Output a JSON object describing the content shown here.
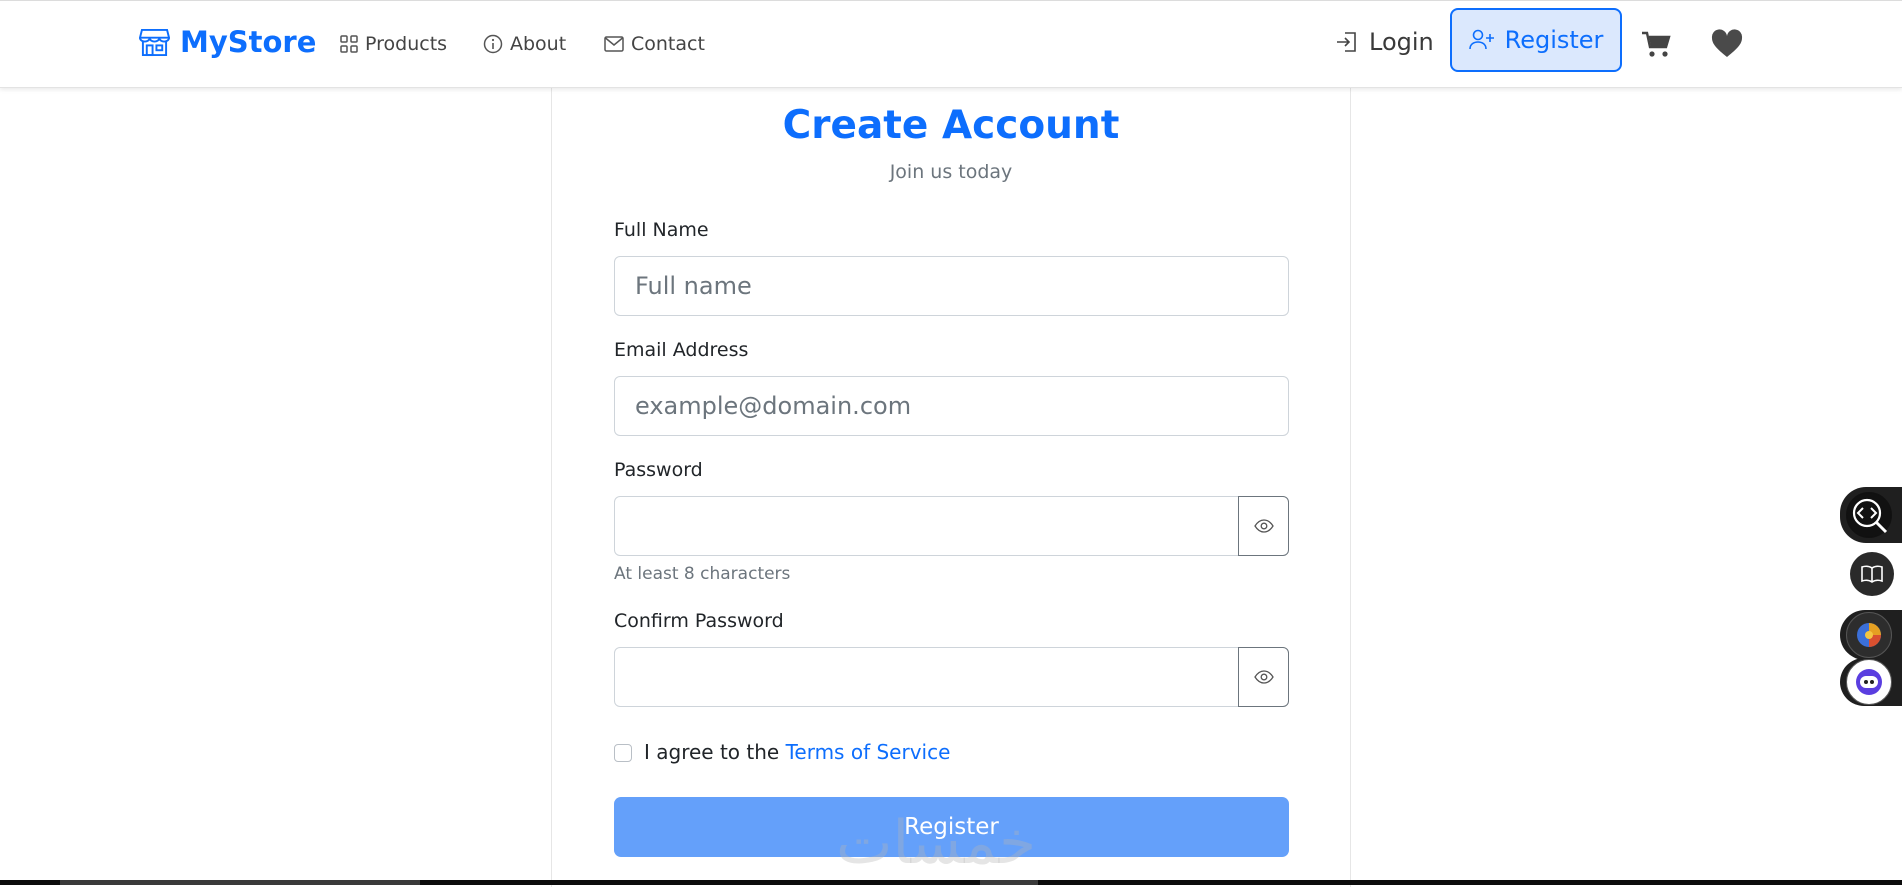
{
  "navbar": {
    "brand": "MyStore",
    "links": [
      {
        "label": "Products",
        "icon": "grid-icon"
      },
      {
        "label": "About",
        "icon": "info-circle-icon"
      },
      {
        "label": "Contact",
        "icon": "envelope-icon"
      }
    ],
    "login_label": "Login",
    "register_label": "Register"
  },
  "form": {
    "title": "Create Account",
    "subtitle": "Join us today",
    "full_name_label": "Full Name",
    "full_name_placeholder": "Full name",
    "email_label": "Email Address",
    "email_placeholder": "example@domain.com",
    "password_label": "Password",
    "password_help": "At least 8 characters",
    "confirm_label": "Confirm Password",
    "agree_text": "I agree to the",
    "terms_link": "Terms of Service",
    "submit_label": "Register"
  },
  "colors": {
    "primary": "#0d6efd",
    "submit_disabled": "#64a0fa",
    "register_btn_bg": "#dbe8fd"
  }
}
